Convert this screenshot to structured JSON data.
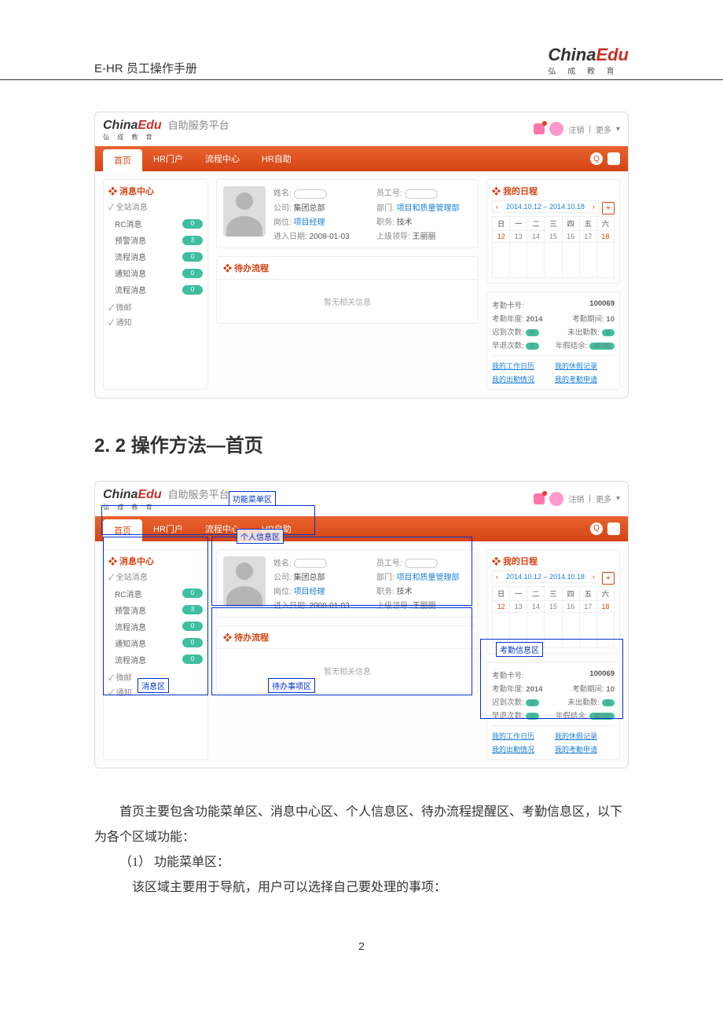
{
  "doc": {
    "header_title": "E-HR 员工操作手册",
    "logo_main1": "China",
    "logo_main2": "Edu",
    "logo_sub": "弘 成 教 育",
    "page_number": "2"
  },
  "section": {
    "title": "2. 2 操作方法—首页",
    "para1": "首页主要包含功能菜单区、消息中心区、个人信息区、待办流程提醒区、考勤信息区，以下为各个区域功能：",
    "item1_label": "（1）  功能菜单区：",
    "item1_body": "该区域主要用于导航，用户可以选择自己要处理的事项："
  },
  "app": {
    "platform_title": "自助服务平台",
    "top_right": {
      "logout": "注销",
      "more": "更多"
    },
    "nav": {
      "home": "首页",
      "hr_portal": "HR门户",
      "process": "流程中心",
      "self": "HR自助"
    },
    "sidebar": {
      "title": "❖ 消息中心",
      "group1": "✓ 全站消息",
      "items": [
        {
          "label": "RC消息",
          "badge": "0"
        },
        {
          "label": "预警消息",
          "badge": "3"
        },
        {
          "label": "流程消息",
          "badge": "0"
        },
        {
          "label": "通知消息",
          "badge": "0"
        },
        {
          "label": "流程消息",
          "badge": "0"
        }
      ],
      "group2": "✓ 微邮",
      "group3": "✓ 通知"
    },
    "profile": {
      "name_l": "姓名:",
      "empid_l": "员工号:",
      "company_l": "公司:",
      "company_v": "集团总部",
      "dept_l": "部门:",
      "dept_v": "项目和质量管理部",
      "post_l": "岗位:",
      "post_v": "项目经理",
      "job_l": "职务:",
      "job_v": "技术",
      "join_l": "进入日期:",
      "join_v": "2008-01-03",
      "leader_l": "上级领导:",
      "leader_v": "王丽丽"
    },
    "pending": {
      "title": "❖ 待办流程",
      "empty": "暂无相关信息"
    },
    "calendar": {
      "title": "❖ 我的日程",
      "range": "2014.10.12 – 2014.10.18",
      "heads": [
        "日",
        "一",
        "二",
        "三",
        "四",
        "五",
        "六"
      ],
      "days": [
        "12",
        "13",
        "14",
        "15",
        "16",
        "17",
        "18"
      ]
    },
    "attendance": {
      "card_l": "考勤卡号:",
      "card_v": "100069",
      "year_l": "考勤年度:",
      "year_v": "2014",
      "period_l": "考勤期间:",
      "period_v": "10",
      "late_l": "迟到次数:",
      "late_v": "0",
      "absent_l": "未出勤数:",
      "absent_v": "0",
      "early_l": "早退次数:",
      "early_v": "0",
      "ann_l": "年假结余:",
      "ann_v": "40:00",
      "links": [
        "我的工作日历",
        "我的休假记录",
        "我的出勤情况",
        "我的考勤申请"
      ]
    }
  },
  "anno": {
    "menu": "功能菜单区",
    "msg": "消息区",
    "info": "个人信息区",
    "pending": "待办事项区",
    "att": "考勤信息区"
  }
}
